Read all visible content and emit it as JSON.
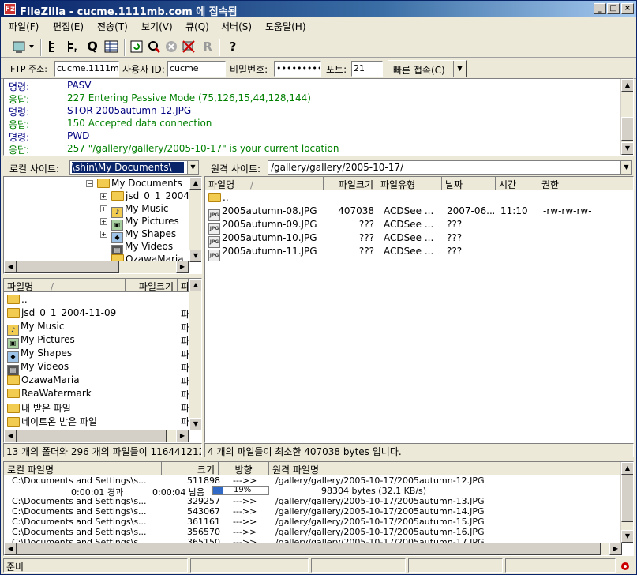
{
  "window": {
    "title": "FileZilla - cucme.1111mb.com 에 접속됨",
    "app_icon": "Fz",
    "minimize": "_",
    "maximize": "□",
    "close": "×"
  },
  "menu": [
    "파일(F)",
    "편집(E)",
    "전송(T)",
    "보기(V)",
    "큐(Q)",
    "서버(S)",
    "도움말(H)"
  ],
  "toolbar": {
    "icons": [
      "site-manager-icon",
      "log-toggle-icon",
      "tree-toggle-icon",
      "queue-toggle-icon",
      "view-toggle-icon",
      "refresh-icon",
      "process-queue-icon",
      "cancel-icon",
      "disconnect-icon",
      "reconnect-icon",
      "help-icon"
    ],
    "glyphs": {
      "queue": "Q",
      "reconnect": "R",
      "help": "?"
    }
  },
  "quickconnect": {
    "host_label": "FTP 주소:",
    "host_value": "cucme.1111mb.",
    "user_label": "사용자 ID:",
    "user_value": "cucme",
    "pass_label": "비밀번호:",
    "pass_value": "•••••••••",
    "port_label": "포트:",
    "port_value": "21",
    "button": "빠른 접속(C)",
    "dropdown": "▼"
  },
  "log": [
    {
      "kind": "명령:",
      "msg": "PASV",
      "color": "#000080"
    },
    {
      "kind": "응답:",
      "msg": "227 Entering Passive Mode (75,126,15,44,128,144)",
      "color": "#008000"
    },
    {
      "kind": "명령:",
      "msg": "STOR 2005autumn-12.JPG",
      "color": "#000080"
    },
    {
      "kind": "응답:",
      "msg": "150 Accepted data connection",
      "color": "#008000"
    },
    {
      "kind": "명령:",
      "msg": "PWD",
      "color": "#000080"
    },
    {
      "kind": "응답:",
      "msg": "257 \"/gallery/gallery/2005-10-17\" is your current location",
      "color": "#008000"
    }
  ],
  "local": {
    "site_label": "로컬 사이트:",
    "path": "\\shin\\My Documents\\",
    "tree": [
      {
        "label": "My Documents",
        "level": 0,
        "expander": "⊟",
        "selected": false,
        "icon": "folder-icon"
      },
      {
        "label": "jsd_0_1_2004-",
        "level": 1,
        "expander": "⊞",
        "icon": "folder-icon"
      },
      {
        "label": "My Music",
        "level": 1,
        "expander": "⊞",
        "icon": "music-folder-icon"
      },
      {
        "label": "My Pictures",
        "level": 1,
        "expander": "⊞",
        "icon": "pictures-folder-icon"
      },
      {
        "label": "My Shapes",
        "level": 1,
        "expander": "⊞",
        "icon": "shapes-folder-icon"
      },
      {
        "label": "My Videos",
        "level": 1,
        "expander": "",
        "icon": "videos-folder-icon"
      },
      {
        "label": "OzawaMaria",
        "level": 1,
        "expander": "",
        "icon": "folder-icon"
      }
    ],
    "columns": [
      "파일명",
      "파일크기",
      "파"
    ],
    "sort_mark": "/",
    "files": [
      {
        "name": "..",
        "type": "",
        "icon": "folder-icon"
      },
      {
        "name": "jsd_0_1_2004-11-09",
        "type": "파",
        "icon": "folder-icon"
      },
      {
        "name": "My Music",
        "type": "파",
        "icon": "music-folder-icon"
      },
      {
        "name": "My Pictures",
        "type": "파",
        "icon": "pictures-folder-icon"
      },
      {
        "name": "My Shapes",
        "type": "파",
        "icon": "shapes-folder-icon"
      },
      {
        "name": "My Videos",
        "type": "파",
        "icon": "videos-folder-icon"
      },
      {
        "name": "OzawaMaria",
        "type": "파",
        "icon": "folder-icon"
      },
      {
        "name": "ReaWatermark",
        "type": "파",
        "icon": "folder-icon"
      },
      {
        "name": "내 받은 파일",
        "type": "파",
        "icon": "folder-icon"
      },
      {
        "name": "네이트온 받은 파일",
        "type": "파",
        "icon": "folder-icon"
      }
    ],
    "status": "13 개의 폴더와 296 개의 파일들이 116441212"
  },
  "remote": {
    "site_label": "원격 사이트:",
    "path": "/gallery/gallery/2005-10-17/",
    "columns": [
      "파일명",
      "파일크기",
      "파일유형",
      "날짜",
      "시간",
      "권한"
    ],
    "sort_mark": "/",
    "files": [
      {
        "name": "..",
        "size": "",
        "type": "",
        "date": "",
        "time": "",
        "perm": "",
        "icon": "folder-icon"
      },
      {
        "name": "2005autumn-08.JPG",
        "size": "407038",
        "type": "ACDSee ...",
        "date": "2007-06...",
        "time": "11:10",
        "perm": "-rw-rw-rw-",
        "icon": "jpg-icon"
      },
      {
        "name": "2005autumn-09.JPG",
        "size": "???",
        "type": "ACDSee ...",
        "date": "???",
        "time": "",
        "perm": "",
        "icon": "jpg-icon"
      },
      {
        "name": "2005autumn-10.JPG",
        "size": "???",
        "type": "ACDSee ...",
        "date": "???",
        "time": "",
        "perm": "",
        "icon": "jpg-icon"
      },
      {
        "name": "2005autumn-11.JPG",
        "size": "???",
        "type": "ACDSee ...",
        "date": "???",
        "time": "",
        "perm": "",
        "icon": "jpg-icon"
      }
    ],
    "status": "4 개의 파일들이 최소한 407038 bytes 입니다."
  },
  "queue": {
    "columns": [
      "로컬 파일명",
      "크기",
      "방향",
      "원격 파일명"
    ],
    "active": {
      "local": "C:\\Documents and Settings\\s...",
      "size": "511898",
      "dir": "--->>",
      "remote": "/gallery/gallery/2005-10-17/2005autumn-12.JPG",
      "elapsed": "0:00:01 경과",
      "remaining": "0:00:04 남음",
      "progress_pct": 19,
      "progress_label": "19%",
      "speed": "98304 bytes (32.1 KB/s)"
    },
    "items": [
      {
        "local": "C:\\Documents and Settings\\s...",
        "size": "329257",
        "dir": "--->>",
        "remote": "/gallery/gallery/2005-10-17/2005autumn-13.JPG"
      },
      {
        "local": "C:\\Documents and Settings\\s...",
        "size": "543067",
        "dir": "--->>",
        "remote": "/gallery/gallery/2005-10-17/2005autumn-14.JPG"
      },
      {
        "local": "C:\\Documents and Settings\\s...",
        "size": "361161",
        "dir": "--->>",
        "remote": "/gallery/gallery/2005-10-17/2005autumn-15.JPG"
      },
      {
        "local": "C:\\Documents and Settings\\s...",
        "size": "356570",
        "dir": "--->>",
        "remote": "/gallery/gallery/2005-10-17/2005autumn-16.JPG"
      },
      {
        "local": "C:\\Documents and Settings\\s...",
        "size": "365150",
        "dir": "--->>",
        "remote": "/gallery/gallery/2005-10-17/2005autumn-17.JPG"
      }
    ]
  },
  "statusbar": {
    "text": "준비"
  },
  "colors": {
    "titlebar": "#0a246a",
    "progress": "#3169c6",
    "command": "#000080",
    "response": "#008000"
  }
}
